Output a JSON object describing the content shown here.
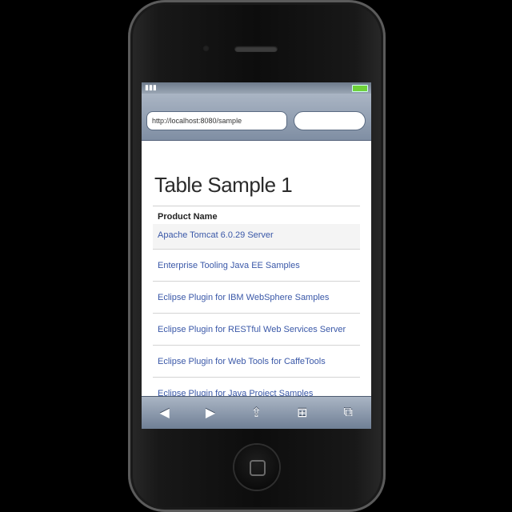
{
  "browser": {
    "address": "http://localhost:8080/sample",
    "search_placeholder": ""
  },
  "page": {
    "title": "Table Sample 1",
    "table_header": "Product Name",
    "rows": [
      "Apache Tomcat 6.0.29 Server",
      "Enterprise Tooling Java EE Samples",
      "Eclipse Plugin for IBM WebSphere Samples",
      "Eclipse Plugin for RESTful Web Services Server",
      "Eclipse Plugin for Web Tools for CaffeTools",
      "Eclipse Plugin for Java Project Samples"
    ]
  },
  "toolbar": {
    "back_icon": "◀",
    "forward_icon": "▶",
    "share_icon": "⇪",
    "bookmarks_icon": "⊞",
    "tabs_icon": "⧉"
  },
  "colors": {
    "link": "#3a58a8",
    "chrome": "#8a98ad"
  }
}
